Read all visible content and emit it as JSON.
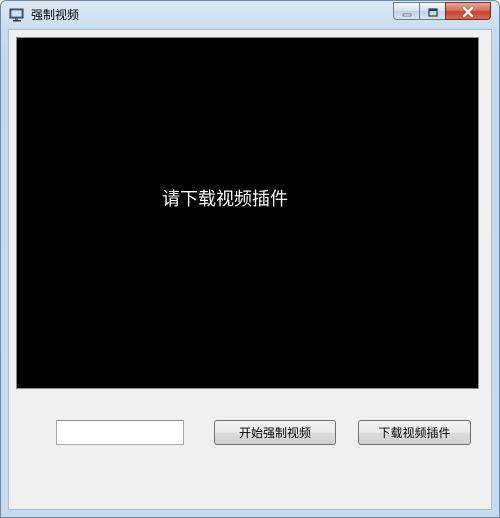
{
  "window": {
    "title": "强制视频",
    "icon": "monitor-icon"
  },
  "controls": {
    "minimize_icon": "minimize-icon",
    "maximize_icon": "maximize-icon",
    "close_icon": "close-icon"
  },
  "video": {
    "message": "请下载视频插件"
  },
  "input": {
    "value": ""
  },
  "buttons": {
    "start_label": "开始强制视频",
    "download_label": "下载视频插件"
  }
}
